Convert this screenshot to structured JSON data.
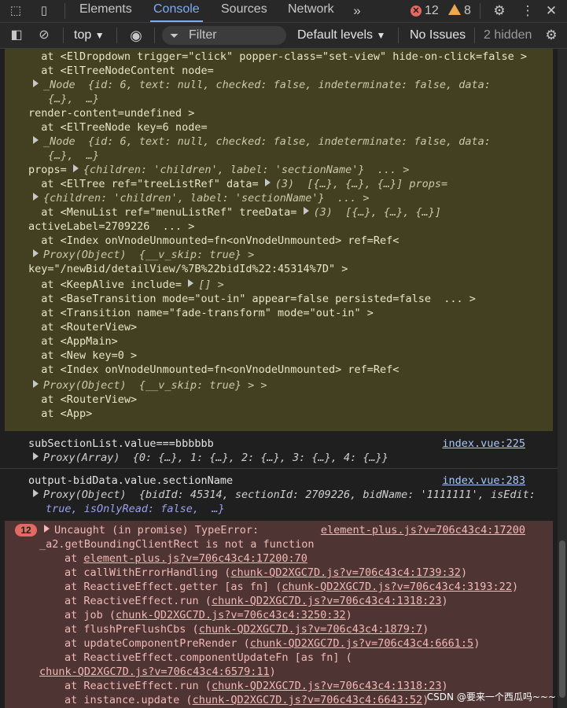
{
  "tabs": {
    "elements": "Elements",
    "console": "Console",
    "sources": "Sources",
    "network": "Network",
    "error_count": "12",
    "warning_count": "8"
  },
  "toolbar": {
    "context": "top",
    "filter_placeholder": "Filter",
    "levels": "Default levels",
    "issues": "No Issues",
    "hidden": "2 hidden"
  },
  "warning_lines": [
    "  at <ElDropdown trigger=\"click\" popper-class=\"set-view\" hide-on-click=false >",
    "  at <ElTreeNodeContent node=",
    "render-content=undefined >",
    "  at <ElTreeNode key=6 node=",
    "props= ",
    "  at <ElTree ref=\"treeListRef\" data= ",
    "  at <MenuList ref=\"menuListRef\" treeData= ",
    "activeLabel=2709226  ... >",
    "  at <Index onVnodeUnmounted=fn<onVnodeUnmounted> ref=Ref<",
    "key=\"/newBid/detailView/%7B%22bidId%22:45314%7D\" >",
    "  at <KeepAlive include= ",
    "  at <BaseTransition mode=\"out-in\" appear=false persisted=false  ... >",
    "  at <Transition name=\"fade-transform\" mode=\"out-in\" >",
    "  at <RouterView>",
    "  at <AppMain>",
    "  at <New key=0 >",
    "  at <Index onVnodeUnmounted=fn<onVnodeUnmounted> ref=Ref<",
    "  at <RouterView>",
    "  at <App>"
  ],
  "node_obj_1": "_Node  {id: 6, text: null, checked: false, indeterminate: false, data:",
  "node_obj_cont": "{…},  …}",
  "props_obj": "{children: 'children', label: 'sectionName'}  ... >",
  "tree_data_tail": "(3)  [{…}, {…}, {…}] props=",
  "props_obj_2": "{children: 'children', label: 'sectionName'}  ... >",
  "menu_tree_tail": "(3)  [{…}, {…}, {…}]",
  "proxy_skip": "Proxy(Object)  {__v_skip: true} >",
  "keepalive_tail": "[] >",
  "proxy_skip_2": "Proxy(Object)  {__v_skip: true} > >",
  "log1": {
    "text": "subSectionList.value===bbbbbb",
    "source": "index.vue:225",
    "detail": "Proxy(Array)  {0: {…}, 1: {…}, 2: {…}, 3: {…}, 4: {…}}"
  },
  "log2": {
    "text": "output-bidData.value.sectionName",
    "source": "index.vue:283",
    "detail1": "Proxy(Object)  {bidId: 45314, sectionId: 2709226, bidName: '1111111', isEdit:",
    "detail2": "true, isOnlyRead: false,  …}"
  },
  "error": {
    "count": "12",
    "message1": "Uncaught (in promise) TypeError:",
    "message2": "_a2.getBoundingClientRect is not a function",
    "source": "element-plus.js?v=706c43c4:17200",
    "stack": [
      {
        "prefix": "at ",
        "fn": "",
        "link": "element-plus.js?v=706c43c4:17200:70"
      },
      {
        "prefix": "at callWithErrorHandling (",
        "fn": "",
        "link": "chunk-QD2XGC7D.js?v=706c43c4:1739:32",
        "suffix": ")"
      },
      {
        "prefix": "at ReactiveEffect.getter [as fn] (",
        "fn": "",
        "link": "chunk-QD2XGC7D.js?v=706c43c4:3193:22",
        "suffix": ")"
      },
      {
        "prefix": "at ReactiveEffect.run (",
        "fn": "",
        "link": "chunk-QD2XGC7D.js?v=706c43c4:1318:23",
        "suffix": ")"
      },
      {
        "prefix": "at job (",
        "fn": "",
        "link": "chunk-QD2XGC7D.js?v=706c43c4:3250:32",
        "suffix": ")"
      },
      {
        "prefix": "at flushPreFlushCbs (",
        "fn": "",
        "link": "chunk-QD2XGC7D.js?v=706c43c4:1879:7",
        "suffix": ")"
      },
      {
        "prefix": "at updateComponentPreRender (",
        "fn": "",
        "link": "chunk-QD2XGC7D.js?v=706c43c4:6661:5",
        "suffix": ")"
      },
      {
        "prefix": "at ReactiveEffect.componentUpdateFn [as fn] (",
        "fn": "",
        "link": "",
        "suffix": ""
      },
      {
        "prefix": "",
        "fn": "",
        "link": "chunk-QD2XGC7D.js?v=706c43c4:6579:11",
        "suffix": ")"
      },
      {
        "prefix": "at ReactiveEffect.run (",
        "fn": "",
        "link": "chunk-QD2XGC7D.js?v=706c43c4:1318:23",
        "suffix": ")"
      },
      {
        "prefix": "at instance.update (",
        "fn": "",
        "link": "chunk-QD2XGC7D.js?v=706c43c4:6643:52",
        "suffix": ")"
      }
    ]
  },
  "watermark": "CSDN @要来一个西瓜吗~~~"
}
